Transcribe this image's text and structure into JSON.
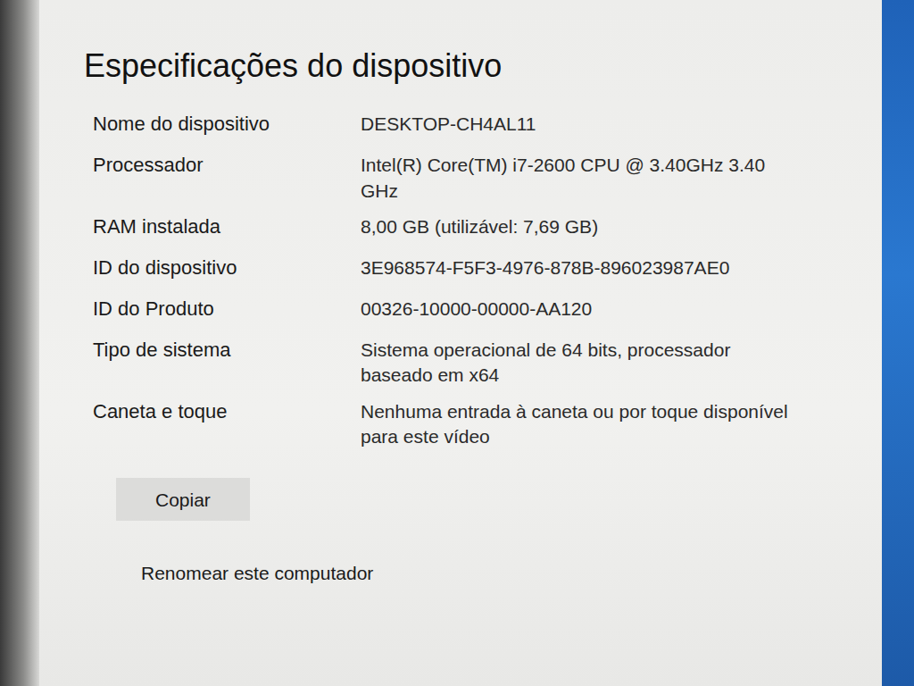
{
  "window": {
    "title": "Especificações do dispositivo"
  },
  "specs": [
    {
      "label": "Nome do dispositivo",
      "value": "DESKTOP-CH4AL11"
    },
    {
      "label": "Processador",
      "value": "Intel(R) Core(TM) i7-2600 CPU @ 3.40GHz 3.40 GHz"
    },
    {
      "label": "RAM instalada",
      "value": "8,00 GB (utilizável: 7,69 GB)"
    },
    {
      "label": "ID do dispositivo",
      "value": "3E968574-F5F3-4976-878B-896023987AE0"
    },
    {
      "label": "ID do Produto",
      "value": "00326-10000-00000-AA120"
    },
    {
      "label": "Tipo de sistema",
      "value": "Sistema operacional de 64 bits, processador baseado em x64"
    },
    {
      "label": "Caneta e toque",
      "value": "Nenhuma entrada à caneta ou por toque disponível para este vídeo"
    }
  ],
  "buttons": [
    "Copiar",
    "Renomear este computador"
  ]
}
